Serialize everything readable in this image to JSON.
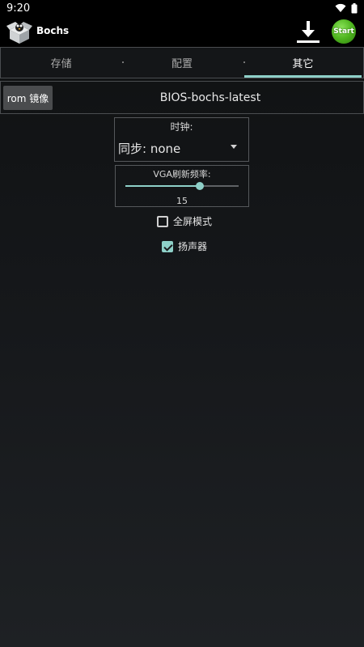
{
  "status_bar": {
    "time": "9:20"
  },
  "app": {
    "title": "Bochs",
    "start_label": "Start"
  },
  "tabs": [
    {
      "label": "存储"
    },
    {
      "label": "配置"
    },
    {
      "label": "其它"
    }
  ],
  "rom": {
    "button_label": "rom 镜像",
    "file_name": "BIOS-bochs-latest"
  },
  "clock": {
    "label": "时钟:",
    "value": "同步:  none"
  },
  "vga": {
    "label": "VGA刷新频率:",
    "value": "15",
    "slider_fraction": 0.66
  },
  "options": [
    {
      "label": "全屏模式",
      "checked": false
    },
    {
      "label": "扬声器",
      "checked": true
    }
  ],
  "colors": {
    "accent": "#8ed0c8",
    "start_green": "#4fb51f"
  }
}
